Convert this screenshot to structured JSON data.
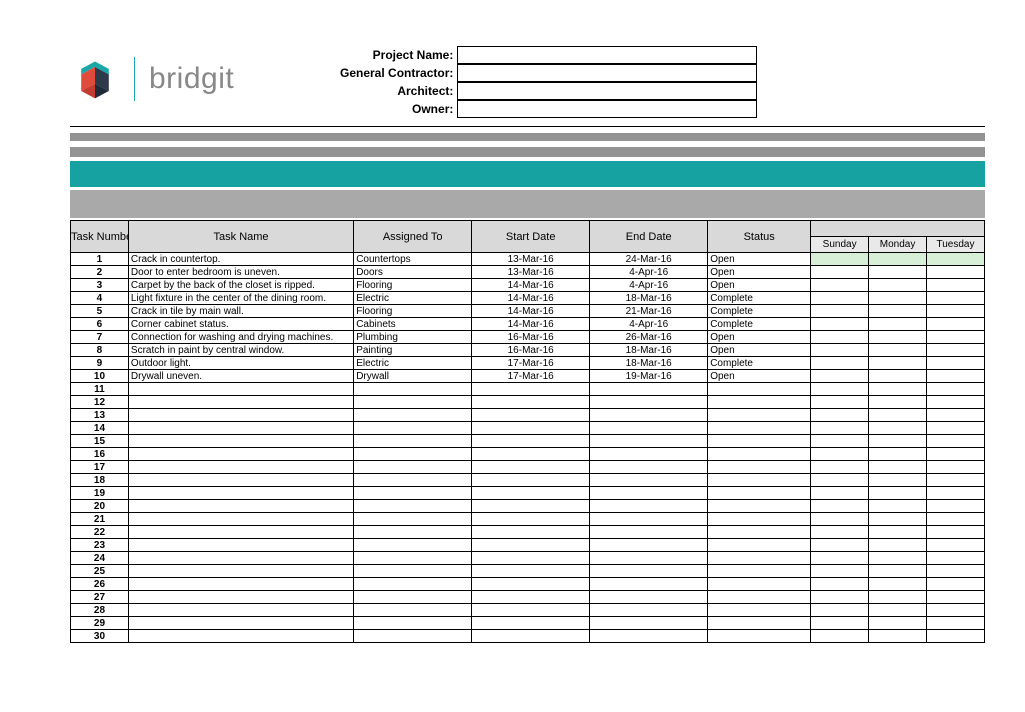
{
  "brand": {
    "name": "bridgit"
  },
  "fields": {
    "project_name_label": "Project Name:",
    "general_contractor_label": "General Contractor:",
    "architect_label": "Architect:",
    "owner_label": "Owner:",
    "project_name": "",
    "general_contractor": "",
    "architect": "",
    "owner": ""
  },
  "columns": {
    "task_number": "Task Number",
    "task_name": "Task Name",
    "assigned_to": "Assigned To",
    "start_date": "Start Date",
    "end_date": "End Date",
    "status": "Status",
    "days": [
      "Sunday",
      "Monday",
      "Tuesday"
    ]
  },
  "rows": [
    {
      "num": "1",
      "name": "Crack in countertop.",
      "assigned": "Countertops",
      "start": "13-Mar-16",
      "end": "24-Mar-16",
      "status": "Open"
    },
    {
      "num": "2",
      "name": "Door to enter bedroom is uneven.",
      "assigned": "Doors",
      "start": "13-Mar-16",
      "end": "4-Apr-16",
      "status": "Open"
    },
    {
      "num": "3",
      "name": "Carpet by the back of the closet is ripped.",
      "assigned": "Flooring",
      "start": "14-Mar-16",
      "end": "4-Apr-16",
      "status": "Open"
    },
    {
      "num": "4",
      "name": "Light fixture in the center of the dining room.",
      "assigned": "Electric",
      "start": "14-Mar-16",
      "end": "18-Mar-16",
      "status": "Complete"
    },
    {
      "num": "5",
      "name": "Crack in tile by main wall.",
      "assigned": "Flooring",
      "start": "14-Mar-16",
      "end": "21-Mar-16",
      "status": "Complete"
    },
    {
      "num": "6",
      "name": "Corner cabinet status.",
      "assigned": "Cabinets",
      "start": "14-Mar-16",
      "end": "4-Apr-16",
      "status": "Complete"
    },
    {
      "num": "7",
      "name": "Connection for washing and drying machines.",
      "assigned": "Plumbing",
      "start": "16-Mar-16",
      "end": "26-Mar-16",
      "status": "Open"
    },
    {
      "num": "8",
      "name": "Scratch in paint by central window.",
      "assigned": "Painting",
      "start": "16-Mar-16",
      "end": "18-Mar-16",
      "status": "Open"
    },
    {
      "num": "9",
      "name": "Outdoor light.",
      "assigned": "Electric",
      "start": "17-Mar-16",
      "end": "18-Mar-16",
      "status": "Complete"
    },
    {
      "num": "10",
      "name": "Drywall uneven.",
      "assigned": "Drywall",
      "start": "17-Mar-16",
      "end": "19-Mar-16",
      "status": "Open"
    },
    {
      "num": "11",
      "name": "",
      "assigned": "",
      "start": "",
      "end": "",
      "status": ""
    },
    {
      "num": "12",
      "name": "",
      "assigned": "",
      "start": "",
      "end": "",
      "status": ""
    },
    {
      "num": "13",
      "name": "",
      "assigned": "",
      "start": "",
      "end": "",
      "status": ""
    },
    {
      "num": "14",
      "name": "",
      "assigned": "",
      "start": "",
      "end": "",
      "status": ""
    },
    {
      "num": "15",
      "name": "",
      "assigned": "",
      "start": "",
      "end": "",
      "status": ""
    },
    {
      "num": "16",
      "name": "",
      "assigned": "",
      "start": "",
      "end": "",
      "status": ""
    },
    {
      "num": "17",
      "name": "",
      "assigned": "",
      "start": "",
      "end": "",
      "status": ""
    },
    {
      "num": "18",
      "name": "",
      "assigned": "",
      "start": "",
      "end": "",
      "status": ""
    },
    {
      "num": "19",
      "name": "",
      "assigned": "",
      "start": "",
      "end": "",
      "status": ""
    },
    {
      "num": "20",
      "name": "",
      "assigned": "",
      "start": "",
      "end": "",
      "status": ""
    },
    {
      "num": "21",
      "name": "",
      "assigned": "",
      "start": "",
      "end": "",
      "status": ""
    },
    {
      "num": "22",
      "name": "",
      "assigned": "",
      "start": "",
      "end": "",
      "status": ""
    },
    {
      "num": "23",
      "name": "",
      "assigned": "",
      "start": "",
      "end": "",
      "status": ""
    },
    {
      "num": "24",
      "name": "",
      "assigned": "",
      "start": "",
      "end": "",
      "status": ""
    },
    {
      "num": "25",
      "name": "",
      "assigned": "",
      "start": "",
      "end": "",
      "status": ""
    },
    {
      "num": "26",
      "name": "",
      "assigned": "",
      "start": "",
      "end": "",
      "status": ""
    },
    {
      "num": "27",
      "name": "",
      "assigned": "",
      "start": "",
      "end": "",
      "status": ""
    },
    {
      "num": "28",
      "name": "",
      "assigned": "",
      "start": "",
      "end": "",
      "status": ""
    },
    {
      "num": "29",
      "name": "",
      "assigned": "",
      "start": "",
      "end": "",
      "status": ""
    },
    {
      "num": "30",
      "name": "",
      "assigned": "",
      "start": "",
      "end": "",
      "status": ""
    }
  ]
}
